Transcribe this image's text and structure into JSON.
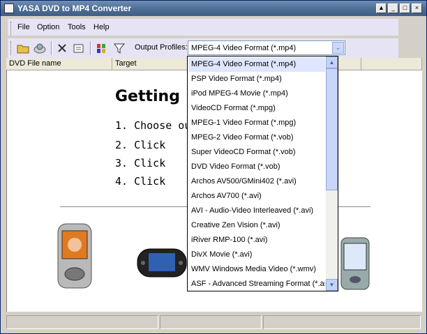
{
  "window": {
    "title": "YASA DVD to MP4 Converter"
  },
  "menu": {
    "items": [
      "File",
      "Option",
      "Tools",
      "Help"
    ]
  },
  "toolbar": {
    "icons": [
      "open-folder-icon",
      "disc-icon",
      "delete-icon",
      "properties-icon",
      "convert-icon",
      "settings-icon"
    ],
    "profile_label": "Output Profiles:",
    "profile_value": "MPEG-4 Video Format (*.mp4)"
  },
  "columns": [
    "DVD File name",
    "Target"
  ],
  "guide": {
    "heading": "Getting",
    "steps": [
      "1. Choose ou",
      "2. Click",
      "3. Click",
      "4. Click"
    ]
  },
  "dropdown": {
    "selected_index": 0,
    "options": [
      "MPEG-4 Video Format (*.mp4)",
      "PSP Video Format (*.mp4)",
      "iPod MPEG-4 Movie (*.mp4)",
      "VideoCD Format (*.mpg)",
      "MPEG-1 Video Format (*.mpg)",
      "MPEG-2 Video Format (*.vob)",
      "Super VideoCD Format (*.vob)",
      "DVD Video Format (*.vob)",
      "Archos AV500/GMini402 (*.avi)",
      "Archos AV700 (*.avi)",
      "AVI - Audio-Video Interleaved (*.avi)",
      "Creative Zen Vision (*.avi)",
      "iRiver RMP-100 (*.avi)",
      "DivX Movie (*.avi)",
      "WMV Windows Media Video (*.wmv)",
      "ASF - Advanced Streaming Format (*.asf)"
    ]
  }
}
